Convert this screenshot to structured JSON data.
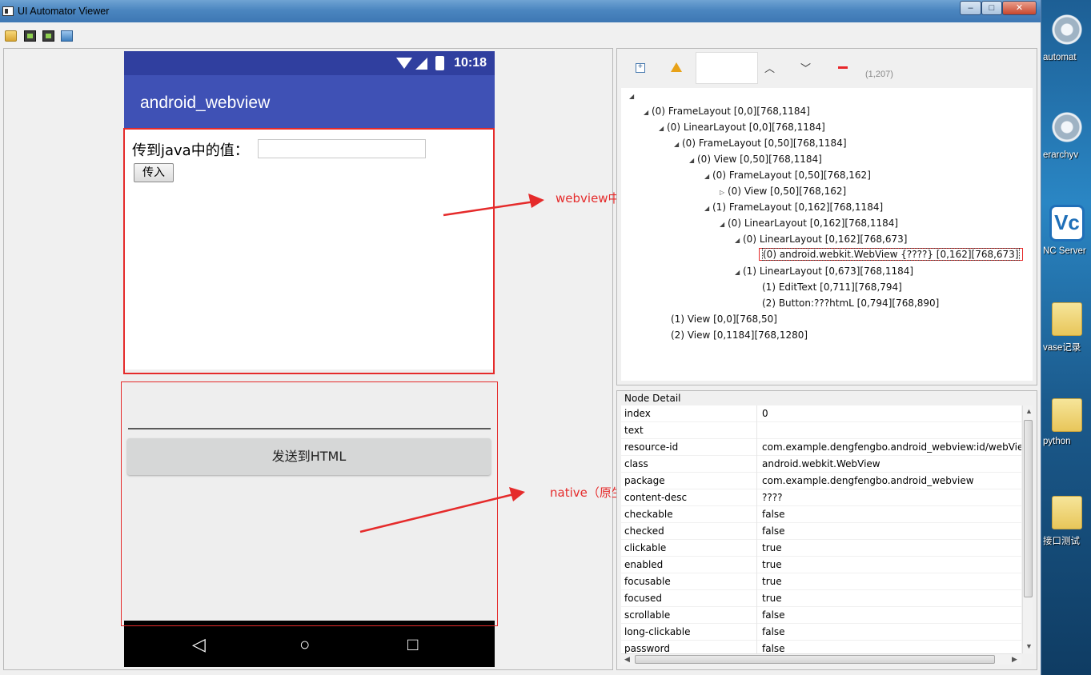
{
  "window": {
    "title": "UI Automator Viewer",
    "controls": [
      "–",
      "□",
      "✕"
    ]
  },
  "desktop_icons": [
    {
      "label": "automat",
      "icon": "gear-icon"
    },
    {
      "label": "erarchyv",
      "icon": "gear-icon"
    },
    {
      "label": "NC Server",
      "icon": "vnc-icon"
    },
    {
      "label": "vase记录",
      "icon": "folder-icon"
    },
    {
      "label": "python",
      "icon": "folder-icon"
    },
    {
      "label": "接口测试",
      "icon": "folder-icon"
    }
  ],
  "device": {
    "status_time": "10:18",
    "app_title": "android_webview",
    "web_label": "传到java中的值：",
    "web_input_value": "",
    "web_button": "传入",
    "native_button": "发送到HTML",
    "nav_back": "◁",
    "nav_home": "○",
    "nav_recent": "□"
  },
  "annotations": {
    "webview": "webview中的内容",
    "native": "native（原生）的内容"
  },
  "tree_toolbar": {
    "up": "︿",
    "down": "﹀",
    "coords": "(1,207)"
  },
  "tree": [
    {
      "text": "",
      "tw": "◢"
    },
    {
      "text": "(0) FrameLayout [0,0][768,1184]",
      "tw": "◢"
    },
    {
      "text": "(0) LinearLayout [0,0][768,1184]",
      "tw": "◢"
    },
    {
      "text": "(0) FrameLayout [0,50][768,1184]",
      "tw": "◢"
    },
    {
      "text": "(0) View [0,50][768,1184]",
      "tw": "◢"
    },
    {
      "text": "(0) FrameLayout [0,50][768,162]",
      "tw": "◢"
    },
    {
      "text": "(0) View [0,50][768,162]",
      "tw": "▷"
    },
    {
      "text": "(1) FrameLayout [0,162][768,1184]",
      "tw": "◢"
    },
    {
      "text": "(0) LinearLayout [0,162][768,1184]",
      "tw": "◢"
    },
    {
      "text": "(0) LinearLayout [0,162][768,673]",
      "tw": "◢"
    },
    {
      "text": "(0) android.webkit.WebView {????} [0,162][768,673]",
      "tw": ""
    },
    {
      "text": "(1) LinearLayout [0,673][768,1184]",
      "tw": "◢"
    },
    {
      "text": "(1) EditText [0,711][768,794]",
      "tw": ""
    },
    {
      "text": "(2) Button:???htmL [0,794][768,890]",
      "tw": ""
    },
    {
      "text": "(1) View [0,0][768,50]",
      "tw": ""
    },
    {
      "text": "(2) View [0,1184][768,1280]",
      "tw": ""
    }
  ],
  "node_detail": {
    "title": "Node Detail",
    "rows": [
      {
        "k": "index",
        "v": "0"
      },
      {
        "k": "text",
        "v": ""
      },
      {
        "k": "resource-id",
        "v": "com.example.dengfengbo.android_webview:id/webView"
      },
      {
        "k": "class",
        "v": "android.webkit.WebView"
      },
      {
        "k": "package",
        "v": "com.example.dengfengbo.android_webview"
      },
      {
        "k": "content-desc",
        "v": "????"
      },
      {
        "k": "checkable",
        "v": "false"
      },
      {
        "k": "checked",
        "v": "false"
      },
      {
        "k": "clickable",
        "v": "true"
      },
      {
        "k": "enabled",
        "v": "true"
      },
      {
        "k": "focusable",
        "v": "true"
      },
      {
        "k": "focused",
        "v": "true"
      },
      {
        "k": "scrollable",
        "v": "false"
      },
      {
        "k": "long-clickable",
        "v": "false"
      },
      {
        "k": "password",
        "v": "false"
      }
    ]
  },
  "colors": {
    "status_bar": "#303f9f",
    "app_bar": "#3f51b5",
    "annotation_red": "#e52b2b"
  }
}
